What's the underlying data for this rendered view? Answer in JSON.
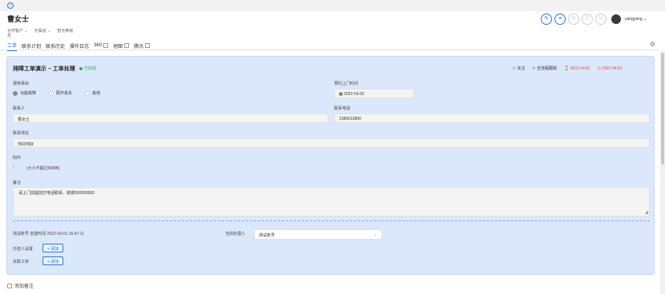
{
  "header": {
    "customer_name": "曹女士",
    "meta": [
      "合作客户 ⌄",
      "无渠道 ⌄",
      "暂无等级"
    ],
    "meta_value": "无",
    "user": "yangyang ⌄"
  },
  "tabs": [
    {
      "label": "工单"
    },
    {
      "label": "联系计划"
    },
    {
      "label": "联系历史"
    },
    {
      "label": "操作日志"
    },
    {
      "label": "360"
    },
    {
      "label": "地图"
    },
    {
      "label": "腾讯"
    }
  ],
  "card": {
    "title": "排障工单演示 – 工单处理",
    "status": "已完成",
    "follow": "关注",
    "tracking": "全流程跟踪",
    "timer1": "3001:54:51",
    "timer2": "2997:54:51",
    "repair_reason_label": "报修事由",
    "repair_options": [
      "功能故障",
      "配件丢失",
      "其他"
    ],
    "visit_time_label": "预约上门时间",
    "visit_time_value": "2022-03-02",
    "contact_label": "联系人",
    "contact_value": "曹女士",
    "phone_label": "联系电话",
    "phone_value": "1380013800",
    "address_label": "联系地址",
    "address_value": "你好你好",
    "attachment_label": "附件",
    "attachment_hint": "(大小不超过50MB)",
    "remark_label": "备注",
    "remark_value": "请上门前提前打电话联系，谢谢000000000",
    "created_by": "测试账号",
    "created_text": "创建时间 2022-03-01 16:47:11",
    "current_handler_label": "当前处理人",
    "current_handler_value": "测试账号",
    "cc_label": "抄送人设置",
    "cc_button": "+ 添加",
    "related_label": "关联工单",
    "related_button": "+ 添加"
  },
  "bottom": {
    "add_note": "添加备注"
  }
}
